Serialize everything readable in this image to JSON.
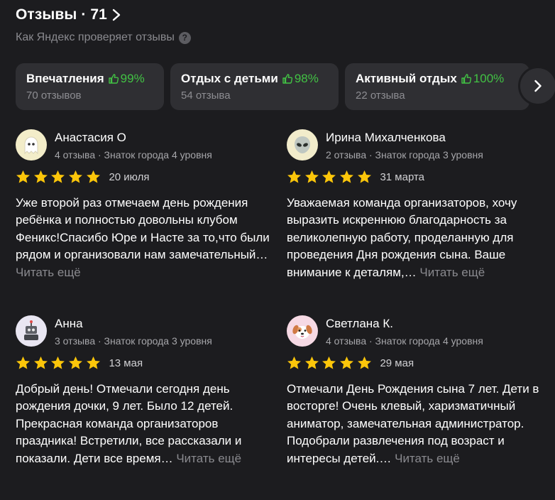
{
  "header": {
    "title": "Отзывы · 71",
    "subtitle": "Как Яндекс проверяет отзывы",
    "help_icon": "question-circle-icon"
  },
  "aspects": [
    {
      "name": "Впечатления",
      "percent": "99%",
      "count": "70 отзывов"
    },
    {
      "name": "Отдых с детьми",
      "percent": "98%",
      "count": "54 отзыва"
    },
    {
      "name": "Активный отдых",
      "percent": "100%",
      "count": "22 отзыва"
    }
  ],
  "colors": {
    "background": "#1c1c1f",
    "card": "#2f2f33",
    "positive": "#42c244",
    "star": "#fcc60a",
    "muted": "#8a8a8f"
  },
  "reviews": [
    {
      "author": "Анастасия О",
      "meta": "4 отзыва · Знаток города 4 уровня",
      "rating": 5,
      "date": "20 июля",
      "text": "Уже второй раз отмечаем день рождения ребёнка и полностью довольны клубом Феникс!Спасибо Юре и Насте за то,что были рядом и организовали нам замечательный…",
      "more": "Читать ещё",
      "avatar_icon": "ghost-avatar-icon"
    },
    {
      "author": "Ирина Михалченкова",
      "meta": "2 отзыва · Знаток города 3 уровня",
      "rating": 5,
      "date": "31 марта",
      "text": "Уважаемая команда организаторов, хочу выразить искреннюю благодарность за великолепную работу, проделанную для проведения Дня рождения сына. Ваше внимание к деталям,…",
      "more": "Читать ещё",
      "avatar_icon": "alien-avatar-icon"
    },
    {
      "author": "Анна",
      "meta": "3 отзыва · Знаток города 3 уровня",
      "rating": 5,
      "date": "13 мая",
      "text": "Добрый день! Отмечали сегодня день рождения дочки, 9 лет. Было 12 детей. Прекрасная команда организаторов праздника! Встретили, все рассказали и показали. Дети все время…",
      "more": "Читать ещё",
      "avatar_icon": "robot-avatar-icon"
    },
    {
      "author": "Светлана К.",
      "meta": "4 отзыва · Знаток города 4 уровня",
      "rating": 5,
      "date": "29 мая",
      "text": "Отмечали День Рождения сына 7 лет. Дети в восторге! Очень клевый, харизматичный аниматор, замечательная администратор. Подобрали развлечения под возраст и интересы детей.…",
      "more": "Читать ещё",
      "avatar_icon": "dog-avatar-icon"
    }
  ]
}
